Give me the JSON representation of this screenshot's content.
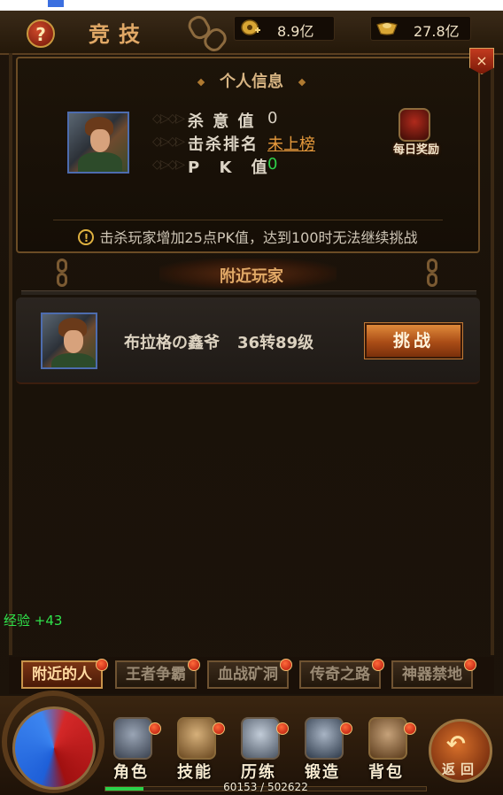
{
  "header": {
    "title": "竞技",
    "help_symbol": "?",
    "currency1": {
      "icon": "coin-icon",
      "value": "8.9亿"
    },
    "currency2": {
      "icon": "ingot-icon",
      "value": "27.8亿"
    }
  },
  "info_panel": {
    "title": "个人信息",
    "close_symbol": "×",
    "stats": [
      {
        "label": "杀 意 值",
        "value": "0",
        "color": "#d9d1c3"
      },
      {
        "label": "击杀排名",
        "value": "未上榜",
        "color": "#e79a3c"
      },
      {
        "label": "P  K  值",
        "value": "0",
        "color": "#2ed14a"
      }
    ],
    "daily_reward_label": "每日奖励",
    "notice_symbol": "!",
    "notice": "击杀玩家增加25点PK值，达到100时无法继续挑战"
  },
  "nearby": {
    "title": "附近玩家",
    "players": [
      {
        "name": "布拉格の鑫爷",
        "level": "36转89级",
        "button": "挑战"
      }
    ]
  },
  "exp_gain": "经验 +43",
  "tabs": [
    {
      "label": "附近的人",
      "active": true
    },
    {
      "label": "王者争霸",
      "active": false
    },
    {
      "label": "血战矿洞",
      "active": false
    },
    {
      "label": "传奇之路",
      "active": false
    },
    {
      "label": "神器禁地",
      "active": false
    }
  ],
  "bottom_menu": [
    {
      "label": "角色",
      "icon": "helmet-icon"
    },
    {
      "label": "技能",
      "icon": "skill-scroll-icon"
    },
    {
      "label": "历练",
      "icon": "winged-helm-icon"
    },
    {
      "label": "锻造",
      "icon": "anvil-hammer-icon"
    },
    {
      "label": "背包",
      "icon": "backpack-icon"
    }
  ],
  "return_label": "返回",
  "exp_progress": {
    "current": 60153,
    "max": 502622,
    "text": "60153 / 502622"
  }
}
